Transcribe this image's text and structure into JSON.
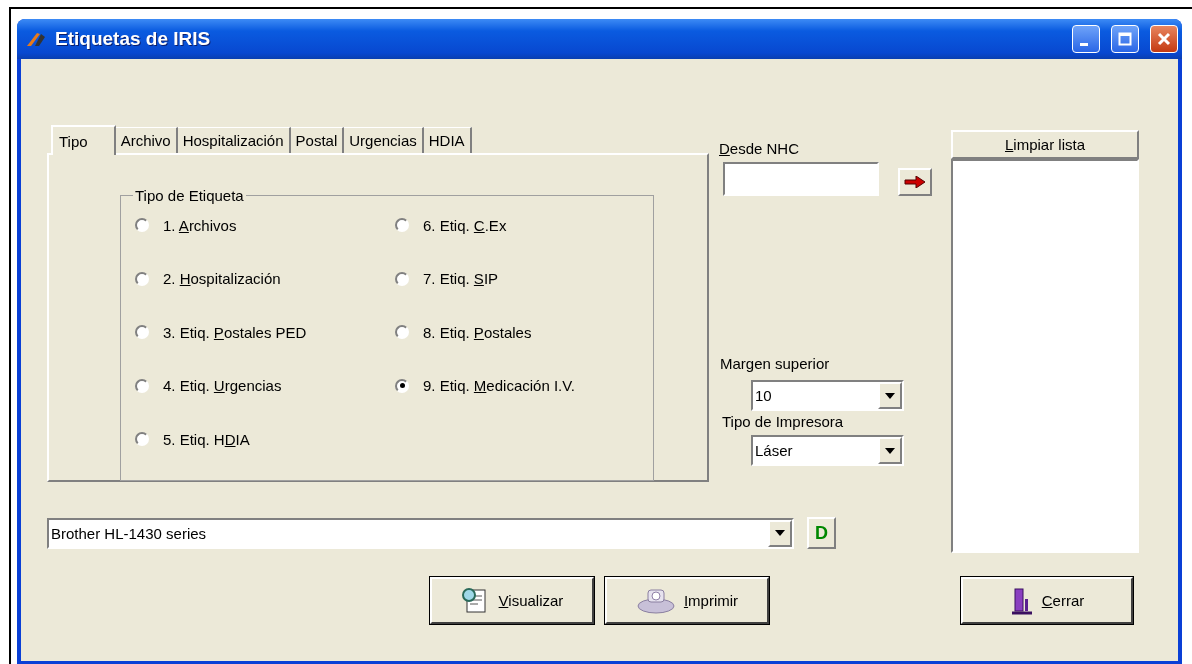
{
  "window": {
    "title": "Etiquetas de IRIS"
  },
  "tabs": [
    {
      "label": "Tipo",
      "selected": true
    },
    {
      "label": "Archivo",
      "selected": false
    },
    {
      "label": "Hospitalización",
      "selected": false
    },
    {
      "label": "Postal",
      "selected": false
    },
    {
      "label": "Urgencias",
      "selected": false
    },
    {
      "label": "HDIA",
      "selected": false
    }
  ],
  "label_type_group": {
    "title": "Tipo de Etiqueta",
    "options": [
      {
        "label": {
          "pre": "1. ",
          "key": "A",
          "post": "rchivos"
        },
        "selected": false
      },
      {
        "label": {
          "pre": "2. ",
          "key": "H",
          "post": "ospitalización"
        },
        "selected": false
      },
      {
        "label": {
          "pre": "3. Etiq. ",
          "key": "P",
          "post": "ostales PED"
        },
        "selected": false
      },
      {
        "label": {
          "pre": "4. Etiq. ",
          "key": "U",
          "post": "rgencias"
        },
        "selected": false
      },
      {
        "label": {
          "pre": "5. Etiq. H",
          "key": "D",
          "post": "IA"
        },
        "selected": false
      },
      {
        "label": {
          "pre": "6. Etiq. ",
          "key": "C",
          "post": ".Ex"
        },
        "selected": false
      },
      {
        "label": {
          "pre": "7. Etiq. ",
          "key": "S",
          "post": "IP"
        },
        "selected": false
      },
      {
        "label": {
          "pre": "8. Etiq. ",
          "key": "P",
          "post": "ostales"
        },
        "selected": false
      },
      {
        "label": {
          "pre": "9. Etiq. ",
          "key": "M",
          "post": "edicación I.V."
        },
        "selected": true
      }
    ]
  },
  "from_nhc": {
    "label": {
      "key": "D",
      "post": "esde  NHC"
    }
  },
  "clear_list_button": {
    "key": "L",
    "post": "impiar lista"
  },
  "top_margin": {
    "label": "Margen superior",
    "value": "10"
  },
  "printer_type": {
    "label": "Tipo de Impresora",
    "value": "Láser"
  },
  "printer": {
    "value": "Brother HL-1430 series"
  },
  "d_button": "D",
  "buttons": [
    {
      "kind": "preview",
      "label": {
        "key": "V",
        "post": "isualizar"
      }
    },
    {
      "kind": "print",
      "label": {
        "key": "I",
        "post": "mprimir"
      }
    },
    {
      "kind": "close",
      "label": {
        "key": "C",
        "post": "errar"
      }
    }
  ]
}
